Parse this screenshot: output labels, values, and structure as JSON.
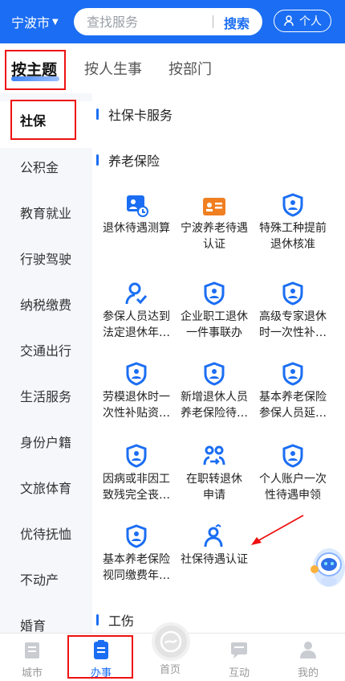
{
  "header": {
    "city": "宁波市",
    "search_placeholder": "查找服务",
    "search_button": "搜索",
    "personal_label": "个人"
  },
  "category_tabs": [
    {
      "label": "按主题",
      "active": true
    },
    {
      "label": "按人生事"
    },
    {
      "label": "按部门"
    }
  ],
  "left_nav": [
    {
      "label": "社保",
      "active": true
    },
    {
      "label": "公积金"
    },
    {
      "label": "教育就业"
    },
    {
      "label": "行驶驾驶"
    },
    {
      "label": "纳税缴费"
    },
    {
      "label": "交通出行"
    },
    {
      "label": "生活服务"
    },
    {
      "label": "身份户籍"
    },
    {
      "label": "文旅体育"
    },
    {
      "label": "优待抚恤"
    },
    {
      "label": "不动产"
    },
    {
      "label": "婚育"
    }
  ],
  "sections": {
    "card": "社保卡服务",
    "pension": "养老保险",
    "injury": "工伤"
  },
  "services": [
    {
      "line1": "退休待遇测算",
      "line2": "",
      "icon": "calculator-icon"
    },
    {
      "line1": "宁波养老待遇",
      "line2": "认证",
      "icon": "id-card-icon"
    },
    {
      "line1": "特殊工种提前",
      "line2": "退休核准",
      "icon": "shield-person-icon"
    },
    {
      "line1": "参保人员达到",
      "line2": "法定退休年…",
      "icon": "person-icon"
    },
    {
      "line1": "企业职工退休",
      "line2": "一件事联办",
      "icon": "shield-person-icon"
    },
    {
      "line1": "高级专家退休",
      "line2": "时一次性补…",
      "icon": "shield-person-icon"
    },
    {
      "line1": "劳模退休时一",
      "line2": "次性补贴资…",
      "icon": "shield-person-icon"
    },
    {
      "line1": "新增退休人员",
      "line2": "养老保险待…",
      "icon": "shield-person-icon"
    },
    {
      "line1": "基本养老保险",
      "line2": "参保人员延…",
      "icon": "shield-person-icon"
    },
    {
      "line1": "因病或非因工",
      "line2": "致残完全丧…",
      "icon": "shield-person-icon"
    },
    {
      "line1": "在职转退休",
      "line2": "申请",
      "icon": "people-transfer-icon"
    },
    {
      "line1": "个人账户一次",
      "line2": "性待遇申领",
      "icon": "shield-person-icon"
    },
    {
      "line1": "基本养老保险",
      "line2": "视同缴费年…",
      "icon": "shield-person-icon"
    },
    {
      "line1": "社保待遇认证",
      "line2": "",
      "icon": "person-verify-icon"
    }
  ],
  "bottom_nav": [
    {
      "label": "城市"
    },
    {
      "label": "办事",
      "active": true
    },
    {
      "label": "首页"
    },
    {
      "label": "互动"
    },
    {
      "label": "我的"
    }
  ],
  "colors": {
    "primary": "#1b6ef3",
    "highlight": "#e11111",
    "orange": "#f07f22"
  }
}
